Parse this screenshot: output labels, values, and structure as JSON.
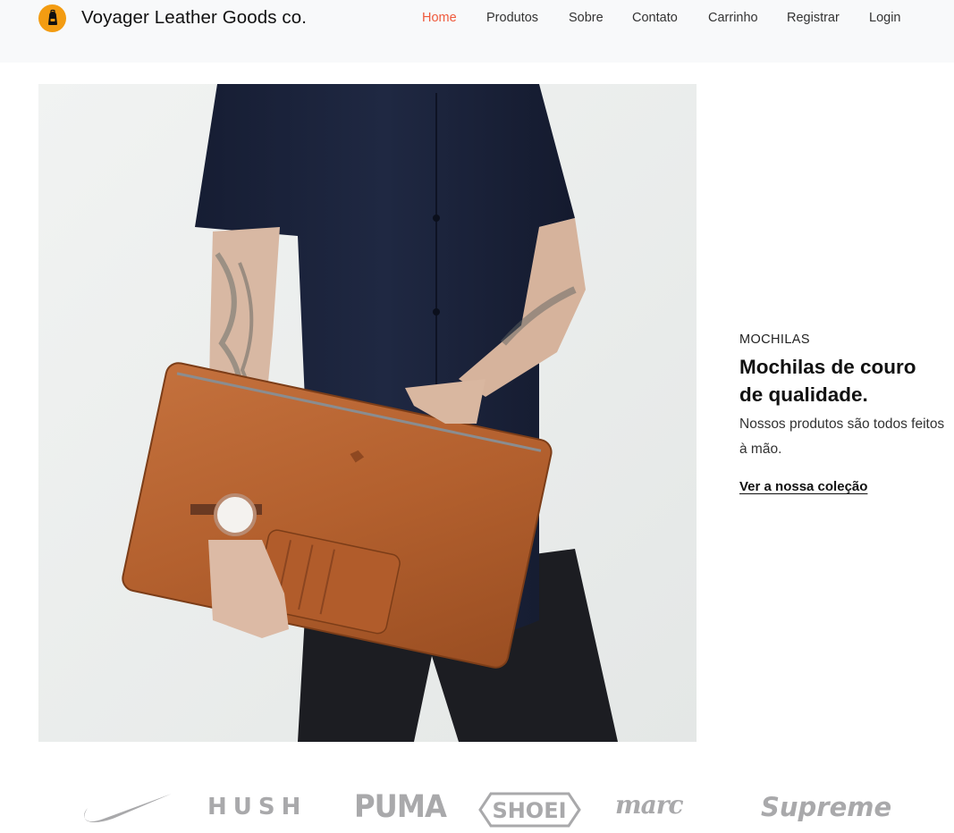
{
  "header": {
    "brand_name": "Voyager Leather Goods co.",
    "logo_icon": "backpack-icon",
    "nav": [
      {
        "label": "Home",
        "active": true
      },
      {
        "label": "Produtos",
        "active": false
      },
      {
        "label": "Sobre",
        "active": false
      },
      {
        "label": "Contato",
        "active": false
      },
      {
        "label": "Carrinho",
        "active": false
      },
      {
        "label": "Registrar",
        "active": false
      },
      {
        "label": "Login",
        "active": false
      }
    ]
  },
  "hero": {
    "category": "MOCHILAS",
    "title": "Mochilas de couro de qualidade.",
    "description": "Nossos produtos são todos feitos à mão.",
    "link_label": "Ver a nossa coleção",
    "image_icon": "leather-bag-photo"
  },
  "brands": {
    "items": [
      {
        "name": "nike",
        "text": ""
      },
      {
        "name": "hush",
        "text": "HUSH"
      },
      {
        "name": "puma",
        "text": "PUMA"
      },
      {
        "name": "shoei",
        "text": "SHOEI"
      },
      {
        "name": "marc",
        "text": "marc"
      },
      {
        "name": "supreme",
        "text": "Supreme"
      }
    ]
  },
  "colors": {
    "accent": "#ef5a3c",
    "logo_bg": "#f39c12",
    "navbar_bg": "#f8f9fa",
    "brand_gray": "#a9a9ab"
  }
}
